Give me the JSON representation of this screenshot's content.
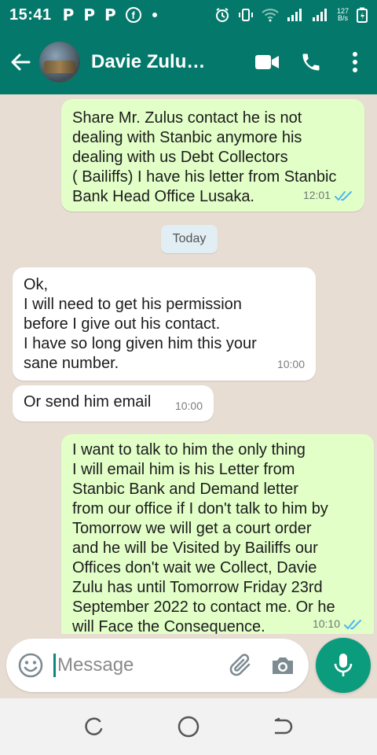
{
  "status": {
    "time": "15:41",
    "notification_letters": [
      "P",
      "P",
      "P"
    ],
    "fb_letter": "f",
    "net_speed_value": "127",
    "net_speed_unit": "B/s"
  },
  "header": {
    "contact_name": "Davie Zulu…",
    "icons": [
      "back-arrow-icon",
      "avatar",
      "video-call-icon",
      "phone-icon",
      "more-vertical-icon"
    ]
  },
  "messages": [
    {
      "direction": "outgoing",
      "lines": [
        "Share Mr. Zulus contact he is not",
        "dealing with Stanbic anymore his",
        "dealing with us Debt Collectors",
        "( Bailiffs) I have his letter from Stanbic",
        "Bank Head Office Lusaka."
      ],
      "time": "12:01",
      "status": "read"
    },
    {
      "direction": "incoming",
      "lines": [
        "Ok,",
        "I will need to get his permission",
        "before I give out his contact.",
        "I have so long given him this your",
        "sane number."
      ],
      "time": "10:00"
    },
    {
      "direction": "incoming",
      "lines": [
        "Or send him email"
      ],
      "time": "10:00"
    },
    {
      "direction": "outgoing",
      "lines": [
        "I want to talk to him the only thing",
        "I will email him is his Letter from",
        "Stanbic Bank and Demand letter",
        "from our office if I don't talk to him by",
        "Tomorrow we will get a court order",
        "and he will be Visited by Bailiffs our",
        "Offices don't wait we Collect, Davie",
        "Zulu has until Tomorrow Friday 23rd",
        "September 2022 to contact me. Or he",
        "will Face the Consequence."
      ],
      "time": "10:10",
      "status": "read"
    }
  ],
  "date_separator": "Today",
  "input": {
    "placeholder": "Message",
    "value": ""
  },
  "colors": {
    "header": "#04796b",
    "outgoing_bubble": "#e2ffc8",
    "incoming_bubble": "#ffffff",
    "accent": "#0a9c7c",
    "read_ticks": "#4fb6ec"
  }
}
